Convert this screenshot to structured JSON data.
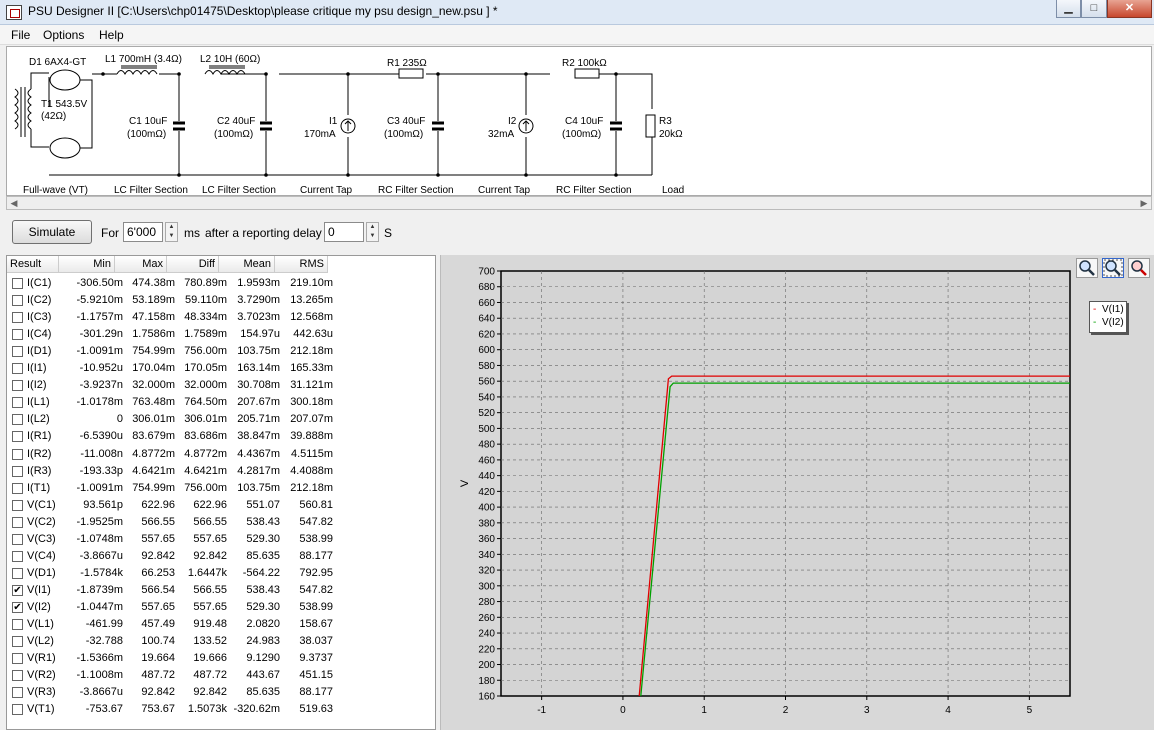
{
  "window": {
    "title": "PSU Designer II  [C:\\Users\\chp01475\\Desktop\\please critique my psu design_new.psu ] *",
    "controls": [
      "minimize",
      "maximize",
      "close"
    ]
  },
  "menu": [
    "File",
    "Options",
    "Help"
  ],
  "schematic": {
    "d1": "D1 6AX4-GT",
    "t1_line1": "T1 543.5V",
    "t1_line2": "(42Ω)",
    "l1": "L1 700mH (3.4Ω)",
    "l2": "L2 10H (60Ω)",
    "r1": "R1 235Ω",
    "r2": "R2 100kΩ",
    "c1_1": "C1 10uF",
    "c1_2": "(100mΩ)",
    "c2_1": "C2 40uF",
    "c2_2": "(100mΩ)",
    "i1_1": "I1",
    "i1_2": "170mA",
    "c3_1": "C3 40uF",
    "c3_2": "(100mΩ)",
    "i2_1": "I2",
    "i2_2": "32mA",
    "c4_1": "C4 10uF",
    "c4_2": "(100mΩ)",
    "r3_1": "R3",
    "r3_2": "20kΩ",
    "sections": [
      "Full-wave (VT)",
      "LC Filter Section",
      "LC Filter Section",
      "Current Tap",
      "RC Filter Section",
      "Current Tap",
      "RC Filter Section",
      "Load"
    ]
  },
  "simulate": {
    "button": "Simulate",
    "for_label": "For",
    "duration": "6'000",
    "ms_label": "ms",
    "delay_label": "after a reporting delay of",
    "delay": "0",
    "s_label": "S"
  },
  "results": {
    "headers": [
      "Result",
      "Min",
      "Max",
      "Diff",
      "Mean",
      "RMS"
    ],
    "rows": [
      {
        "name": "I(C1)",
        "checked": false,
        "min": "-306.50m",
        "max": "474.38m",
        "diff": "780.89m",
        "mean": "1.9593m",
        "rms": "219.10m"
      },
      {
        "name": "I(C2)",
        "checked": false,
        "min": "-5.9210m",
        "max": "53.189m",
        "diff": "59.110m",
        "mean": "3.7290m",
        "rms": "13.265m"
      },
      {
        "name": "I(C3)",
        "checked": false,
        "min": "-1.1757m",
        "max": "47.158m",
        "diff": "48.334m",
        "mean": "3.7023m",
        "rms": "12.568m"
      },
      {
        "name": "I(C4)",
        "checked": false,
        "min": "-301.29n",
        "max": "1.7586m",
        "diff": "1.7589m",
        "mean": "154.97u",
        "rms": "442.63u"
      },
      {
        "name": "I(D1)",
        "checked": false,
        "min": "-1.0091m",
        "max": "754.99m",
        "diff": "756.00m",
        "mean": "103.75m",
        "rms": "212.18m"
      },
      {
        "name": "I(I1)",
        "checked": false,
        "min": "-10.952u",
        "max": "170.04m",
        "diff": "170.05m",
        "mean": "163.14m",
        "rms": "165.33m"
      },
      {
        "name": "I(I2)",
        "checked": false,
        "min": "-3.9237n",
        "max": "32.000m",
        "diff": "32.000m",
        "mean": "30.708m",
        "rms": "31.121m"
      },
      {
        "name": "I(L1)",
        "checked": false,
        "min": "-1.0178m",
        "max": "763.48m",
        "diff": "764.50m",
        "mean": "207.67m",
        "rms": "300.18m"
      },
      {
        "name": "I(L2)",
        "checked": false,
        "min": "0",
        "max": "306.01m",
        "diff": "306.01m",
        "mean": "205.71m",
        "rms": "207.07m"
      },
      {
        "name": "I(R1)",
        "checked": false,
        "min": "-6.5390u",
        "max": "83.679m",
        "diff": "83.686m",
        "mean": "38.847m",
        "rms": "39.888m"
      },
      {
        "name": "I(R2)",
        "checked": false,
        "min": "-11.008n",
        "max": "4.8772m",
        "diff": "4.8772m",
        "mean": "4.4367m",
        "rms": "4.5115m"
      },
      {
        "name": "I(R3)",
        "checked": false,
        "min": "-193.33p",
        "max": "4.6421m",
        "diff": "4.6421m",
        "mean": "4.2817m",
        "rms": "4.4088m"
      },
      {
        "name": "I(T1)",
        "checked": false,
        "min": "-1.0091m",
        "max": "754.99m",
        "diff": "756.00m",
        "mean": "103.75m",
        "rms": "212.18m"
      },
      {
        "name": "V(C1)",
        "checked": false,
        "min": "93.561p",
        "max": "622.96",
        "diff": "622.96",
        "mean": "551.07",
        "rms": "560.81"
      },
      {
        "name": "V(C2)",
        "checked": false,
        "min": "-1.9525m",
        "max": "566.55",
        "diff": "566.55",
        "mean": "538.43",
        "rms": "547.82"
      },
      {
        "name": "V(C3)",
        "checked": false,
        "min": "-1.0748m",
        "max": "557.65",
        "diff": "557.65",
        "mean": "529.30",
        "rms": "538.99"
      },
      {
        "name": "V(C4)",
        "checked": false,
        "min": "-3.8667u",
        "max": "92.842",
        "diff": "92.842",
        "mean": "85.635",
        "rms": "88.177"
      },
      {
        "name": "V(D1)",
        "checked": false,
        "min": "-1.5784k",
        "max": "66.253",
        "diff": "1.6447k",
        "mean": "-564.22",
        "rms": "792.95"
      },
      {
        "name": "V(I1)",
        "checked": true,
        "min": "-1.8739m",
        "max": "566.54",
        "diff": "566.55",
        "mean": "538.43",
        "rms": "547.82"
      },
      {
        "name": "V(I2)",
        "checked": true,
        "min": "-1.0447m",
        "max": "557.65",
        "diff": "557.65",
        "mean": "529.30",
        "rms": "538.99"
      },
      {
        "name": "V(L1)",
        "checked": false,
        "min": "-461.99",
        "max": "457.49",
        "diff": "919.48",
        "mean": "2.0820",
        "rms": "158.67"
      },
      {
        "name": "V(L2)",
        "checked": false,
        "min": "-32.788",
        "max": "100.74",
        "diff": "133.52",
        "mean": "24.983",
        "rms": "38.037"
      },
      {
        "name": "V(R1)",
        "checked": false,
        "min": "-1.5366m",
        "max": "19.664",
        "diff": "19.666",
        "mean": "9.1290",
        "rms": "9.3737"
      },
      {
        "name": "V(R2)",
        "checked": false,
        "min": "-1.1008m",
        "max": "487.72",
        "diff": "487.72",
        "mean": "443.67",
        "rms": "451.15"
      },
      {
        "name": "V(R3)",
        "checked": false,
        "min": "-3.8667u",
        "max": "92.842",
        "diff": "92.842",
        "mean": "85.635",
        "rms": "88.177"
      },
      {
        "name": "V(T1)",
        "checked": false,
        "min": "-753.67",
        "max": "753.67",
        "diff": "1.5073k",
        "mean": "-320.62m",
        "rms": "519.63"
      }
    ]
  },
  "chart_data": {
    "type": "line",
    "ylabel": "V",
    "xlim": [
      -1.5,
      5.5
    ],
    "ylim": [
      160,
      700
    ],
    "xticks": [
      -1,
      0,
      1,
      2,
      3,
      4,
      5
    ],
    "yticks": [
      160,
      180,
      200,
      220,
      240,
      260,
      280,
      300,
      320,
      340,
      360,
      380,
      400,
      420,
      440,
      460,
      480,
      500,
      520,
      540,
      560,
      580,
      600,
      620,
      640,
      660,
      680,
      700
    ],
    "grid": true,
    "legend_position": "top-right",
    "series": [
      {
        "name": "V(I1)",
        "color": "#e00000",
        "points": [
          [
            0.2,
            160
          ],
          [
            0.56,
            563
          ],
          [
            0.6,
            566.5
          ],
          [
            5.5,
            566.5
          ]
        ]
      },
      {
        "name": "V(I2)",
        "color": "#00a000",
        "points": [
          [
            0.22,
            160
          ],
          [
            0.58,
            553
          ],
          [
            0.62,
            557.6
          ],
          [
            5.5,
            557.6
          ]
        ]
      }
    ]
  }
}
